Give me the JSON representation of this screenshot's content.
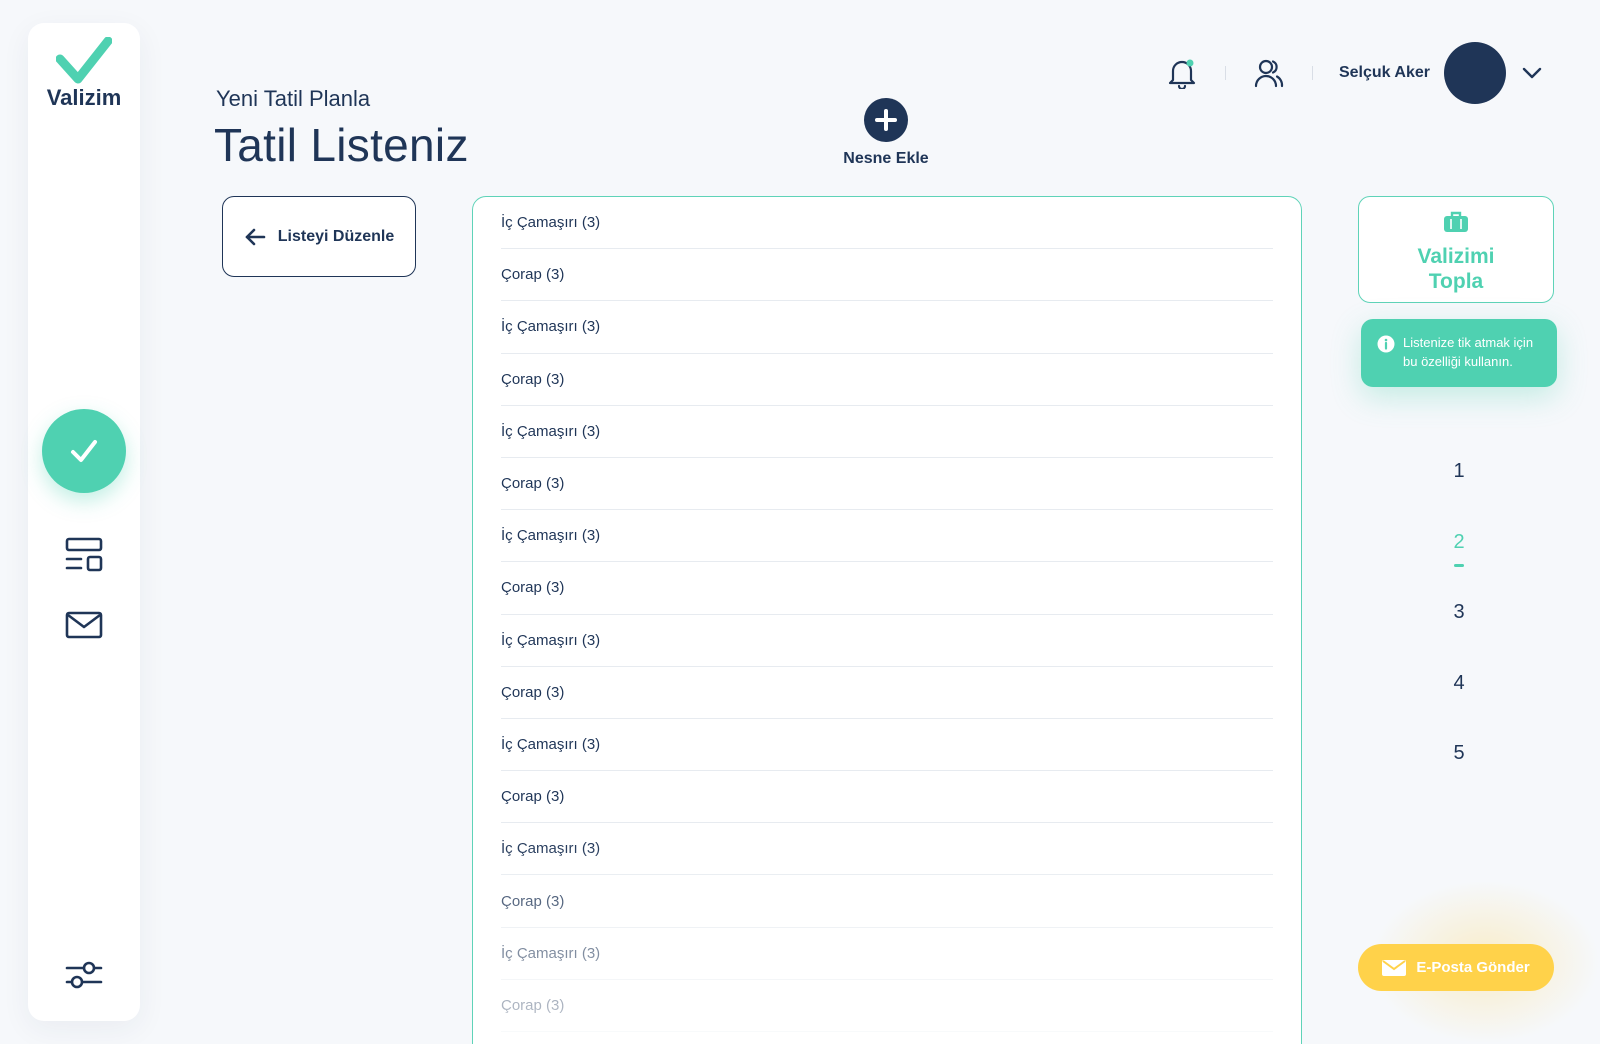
{
  "app": {
    "logo_text": "Valizim"
  },
  "header": {
    "subtitle": "Yeni Tatil Planla",
    "title": "Tatil Listeniz"
  },
  "add_item": {
    "label": "Nesne Ekle"
  },
  "user": {
    "name": "Selçuk Aker"
  },
  "edit_list": {
    "label": "Listeyi Düzenle"
  },
  "items": [
    "İç Çamaşırı (3)",
    "Çorap (3)",
    "İç Çamaşırı (3)",
    "Çorap (3)",
    "İç Çamaşırı (3)",
    "Çorap (3)",
    "İç Çamaşırı (3)",
    "Çorap (3)",
    "İç Çamaşırı (3)",
    "Çorap (3)",
    "İç Çamaşırı (3)",
    "Çorap (3)",
    "İç Çamaşırı (3)",
    "Çorap (3)",
    "İç Çamaşırı (3)",
    "Çorap (3)"
  ],
  "pack": {
    "line1": "Valizimi",
    "line2": "Topla",
    "tooltip": "Listenize tik atmak için bu özelliği kullanın."
  },
  "pagination": {
    "pages": [
      "1",
      "2",
      "3",
      "4",
      "5"
    ],
    "active": "2"
  },
  "email": {
    "label": "E-Posta Gönder"
  },
  "colors": {
    "primary": "#1f3557",
    "accent": "#4fd1b1",
    "yellow": "#ffd24a"
  },
  "icons": {
    "logo": "check-logo-icon",
    "nav_active": "check-icon",
    "nav_layout": "layout-icon",
    "nav_mail": "mail-icon",
    "nav_settings": "sliders-icon",
    "bell": "bell-icon",
    "users": "users-icon",
    "chevron": "chevron-down-icon",
    "back": "arrow-left-icon",
    "suitcase": "suitcase-icon",
    "info": "info-icon",
    "add": "plus-icon"
  }
}
